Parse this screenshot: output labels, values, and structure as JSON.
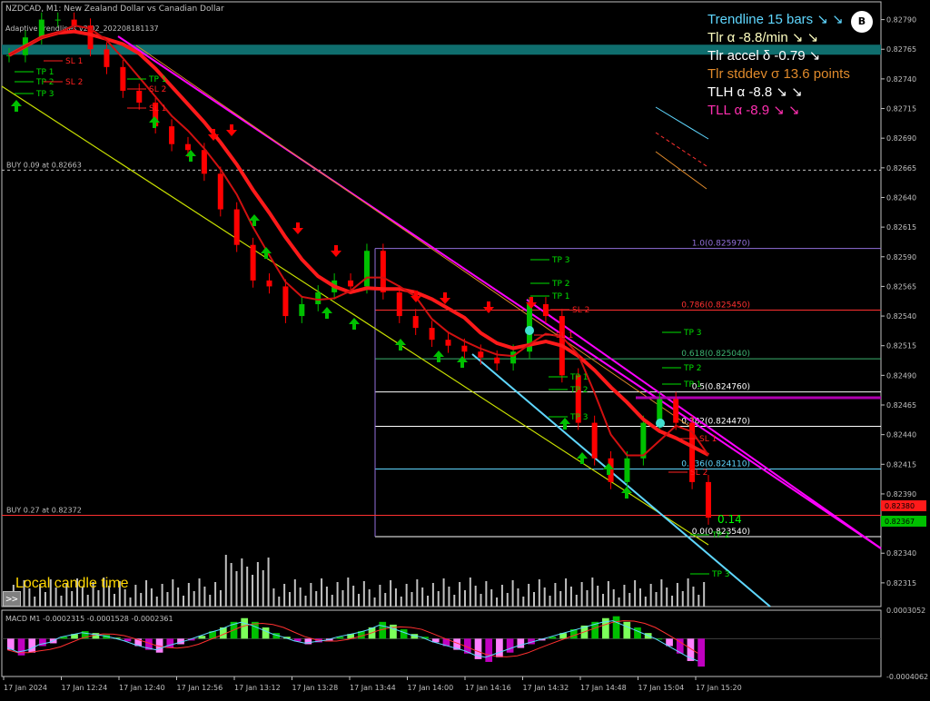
{
  "window": {
    "symbol_line": "NZDCAD, M1: New Zealand Dollar vs Canadian Dollar",
    "indicator_line": "Adaptive Trendlines v2.02_202208181137"
  },
  "hud": {
    "lines": [
      {
        "text": "Trendline 15 bars ↘ ↘",
        "color": "#5fd7ff"
      },
      {
        "text": "Tlr α -8.8/min ↘ ↘",
        "color": "#ffffc0"
      },
      {
        "text": "Tlr accel δ -0.79 ↘",
        "color": "#ffffff"
      },
      {
        "text": "Tlr stddev σ 13.6 points",
        "color": "#e08a2b"
      },
      {
        "text": "TLH α -8.8 ↘ ↘",
        "color": "#ffffff"
      },
      {
        "text": "TLL α -8.9 ↘ ↘",
        "color": "#ff2fb0"
      }
    ],
    "logo_text": "B"
  },
  "local_time_label": "Local candle time",
  "scroll_button": ">>",
  "colors": {
    "background": "#000000",
    "bull": "#00c000",
    "bear": "#ff0000",
    "teal_band": "#0f6e6e",
    "upper_channel": "#ff00ff",
    "lower_channel": "#5fd7ff",
    "yellow_channel": "#c8e000",
    "ma_red": "#ff1a1a",
    "ma_green": "#7cff5a",
    "fib": "#ffffff"
  },
  "chart_data": [
    {
      "type": "candlestick",
      "title": "NZDCAD, M1: New Zealand Dollar vs Canadian Dollar",
      "ylim": [
        0.82295,
        0.82805
      ],
      "yticks": [
        "0.82790",
        "0.82765",
        "0.82740",
        "0.82715",
        "0.82690",
        "0.82665",
        "0.82640",
        "0.82615",
        "0.82590",
        "0.82565",
        "0.82540",
        "0.82515",
        "0.82490",
        "0.82465",
        "0.82440",
        "0.82415",
        "0.82390",
        "0.82365",
        "0.82340",
        "0.82315"
      ],
      "xticks": [
        "17 Jan 2024",
        "17 Jan 12:24",
        "17 Jan 12:40",
        "17 Jan 12:56",
        "17 Jan 13:12",
        "17 Jan 13:28",
        "17 Jan 13:44",
        "17 Jan 14:00",
        "17 Jan 14:16",
        "17 Jan 14:32",
        "17 Jan 14:48",
        "17 Jan 15:04",
        "17 Jan 15:20"
      ],
      "close_path": [
        0.8276,
        0.82775,
        0.8279,
        0.8279,
        0.82785,
        0.82765,
        0.8275,
        0.8273,
        0.8272,
        0.827,
        0.82685,
        0.8268,
        0.8266,
        0.8263,
        0.826,
        0.8257,
        0.82565,
        0.8254,
        0.8255,
        0.8256,
        0.8257,
        0.82565,
        0.82595,
        0.8256,
        0.8254,
        0.8253,
        0.8252,
        0.82515,
        0.8251,
        0.82505,
        0.825,
        0.8251,
        0.8255,
        0.8254,
        0.8249,
        0.8245,
        0.8242,
        0.824,
        0.8242,
        0.8245,
        0.8247,
        0.8245,
        0.824,
        0.8237
      ],
      "price_labels": [
        {
          "text": "0.82380",
          "value": 0.8238,
          "bg": "#ff1a1a"
        },
        {
          "text": "0.82367",
          "value": 0.82367,
          "bg": "#00c000"
        }
      ],
      "horizontal_lines": [
        {
          "label": "BUY 0.09 at 0.82663",
          "value": 0.82663,
          "style": "dashed",
          "color": "#c0c0c0"
        },
        {
          "label": "BUY 0.27 at 0.82372",
          "value": 0.82372,
          "style": "solid",
          "color": "#ff3030"
        }
      ],
      "fib_levels": [
        {
          "label": "1.0(0.825970)",
          "value": 0.82597,
          "color": "#9370db"
        },
        {
          "label": "0.786(0.825450)",
          "value": 0.82545,
          "color": "#ff3030"
        },
        {
          "label": "0.618(0.825040)",
          "value": 0.82504,
          "color": "#3cb371"
        },
        {
          "label": "0.5(0.824760)",
          "value": 0.82476,
          "color": "#ffffff"
        },
        {
          "label": "0.382(0.824470)",
          "value": 0.82447,
          "color": "#ffffff"
        },
        {
          "label": "0.236(0.824110)",
          "value": 0.82411,
          "color": "#5fd7ff"
        },
        {
          "label": "0.0(0.823540)",
          "value": 0.82354,
          "color": "#ffffff"
        }
      ],
      "level_labels": [
        "TP 3",
        "TP 2",
        "TP 1",
        "SL 2",
        "SL 1",
        "TP 1",
        "TP 2",
        "TP 3",
        "SL 1",
        "SL 2",
        "TP 1",
        "TP 2",
        "TP 3",
        "TP 3",
        "TP 2",
        "TP 1",
        "SL 2",
        "SL 1",
        "TP 2",
        "TP 3",
        "TP 1",
        "SL 1",
        "SL 2"
      ],
      "annotations": [
        "0.14"
      ]
    },
    {
      "type": "bar",
      "title": "MACD M1 -0.0002315 -0.0001528 -0.0002361",
      "ylim": [
        -0.0004062,
        0.0003052
      ],
      "yticks": [
        "0.0003052",
        "-0.0004062"
      ],
      "histogram": [
        -0.00012,
        -0.00018,
        -0.00015,
        -8e-05,
        -5e-05,
        2e-05,
        5e-05,
        8e-05,
        6e-05,
        4e-05,
        1e-05,
        -3e-05,
        -8e-05,
        -0.00012,
        -0.00015,
        -0.0001,
        -6e-05,
        -2e-05,
        3e-05,
        8e-05,
        0.00012,
        0.00018,
        0.00022,
        0.00018,
        0.00012,
        6e-05,
        2e-05,
        -3e-05,
        -6e-05,
        -4e-05,
        -2e-05,
        2e-05,
        5e-05,
        8e-05,
        0.00012,
        0.00018,
        0.00015,
        0.0001,
        5e-05,
        2e-05,
        -4e-05,
        -8e-05,
        -0.00012,
        -0.00016,
        -0.00022,
        -0.00025,
        -0.0002,
        -0.00015,
        -0.0001,
        -6e-05,
        -2e-05,
        2e-05,
        6e-05,
        0.0001,
        0.00014,
        0.00018,
        0.00022,
        0.00024,
        0.00018,
        0.00012,
        6e-05,
        0.0,
        -8e-05,
        -0.00016,
        -0.00024,
        -0.0003
      ]
    }
  ]
}
